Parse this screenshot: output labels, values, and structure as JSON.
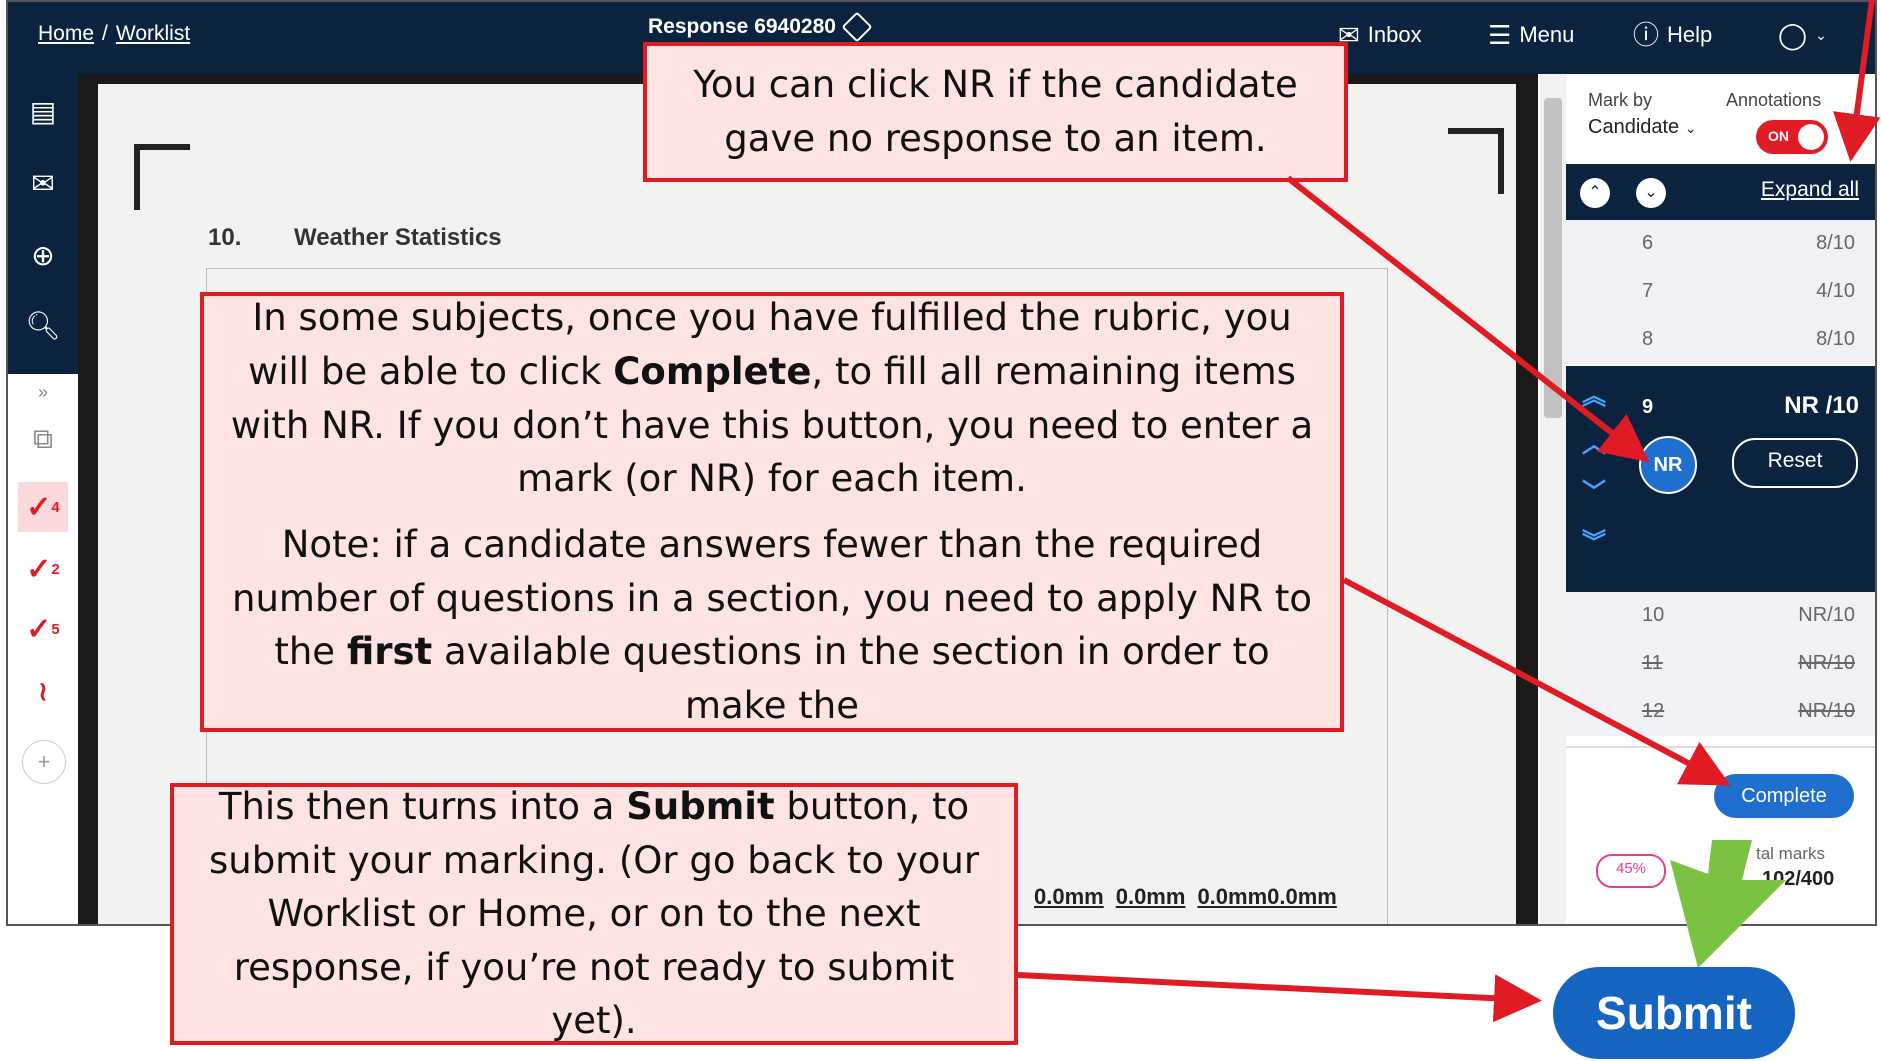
{
  "header": {
    "breadcrumb": [
      "Home",
      "Worklist"
    ],
    "separator": "/",
    "response_title": "Response 6940280",
    "nav": {
      "inbox": "Inbox",
      "menu": "Menu",
      "help": "Help"
    }
  },
  "document": {
    "question_number": "10.",
    "question_title": "Weather Statistics",
    "measurements": [
      "0.0mm",
      "0.0mm",
      "0.0mm0.0mm"
    ]
  },
  "toolbar": {
    "ticks": [
      {
        "symbol": "✓",
        "sub": "4"
      },
      {
        "symbol": "✓",
        "sub": "2"
      },
      {
        "symbol": "✓",
        "sub": "5"
      }
    ],
    "add": "+"
  },
  "panel": {
    "mark_by_label": "Mark by",
    "mark_by_value": "Candidate",
    "annotations_label": "Annotations",
    "annotations_toggle": "ON",
    "expand_all": "Expand all",
    "items": [
      {
        "n": "6",
        "m": "8/10"
      },
      {
        "n": "7",
        "m": "4/10"
      },
      {
        "n": "8",
        "m": "8/10"
      }
    ],
    "selected": {
      "n": "9",
      "m": "NR /10",
      "nr": "NR",
      "reset": "Reset"
    },
    "items_after": [
      {
        "n": "10",
        "m": "NR/10",
        "strike": false
      },
      {
        "n": "11",
        "m": "NR/10",
        "strike": true
      },
      {
        "n": "12",
        "m": "NR/10",
        "strike": true
      }
    ],
    "complete": "Complete",
    "progress": "45%",
    "total_marks_label": "tal marks",
    "total_marks_value": "102/400"
  },
  "callouts": {
    "nr": "You can click NR if the candidate gave no response to an item.",
    "complete_p1_a": "In some subjects, once you have fulfilled the rubric, you will be able to click ",
    "complete_p1_b": "Complete",
    "complete_p1_c": ", to fill all remaining items with NR.  If you don’t have this button, you need to enter a mark (or NR) for each item.",
    "complete_p2_a": "Note: if a candidate answers fewer than the required number of questions in a section, you need to apply NR to the ",
    "complete_p2_b": "first",
    "complete_p2_c": " available questions in the section in order to make the",
    "submit_a": "This then turns into a ",
    "submit_b": "Submit",
    "submit_c": " button, to submit your marking.  (Or go back to your Worklist or Home, or on to the next response, if you’re not ready to submit yet)."
  },
  "submit_button": "Submit",
  "colors": {
    "navy": "#0c2340",
    "red": "#e01b24",
    "callout_fill": "#fde3e1",
    "blue": "#1f6fce",
    "green_arrow": "#7cc242"
  }
}
